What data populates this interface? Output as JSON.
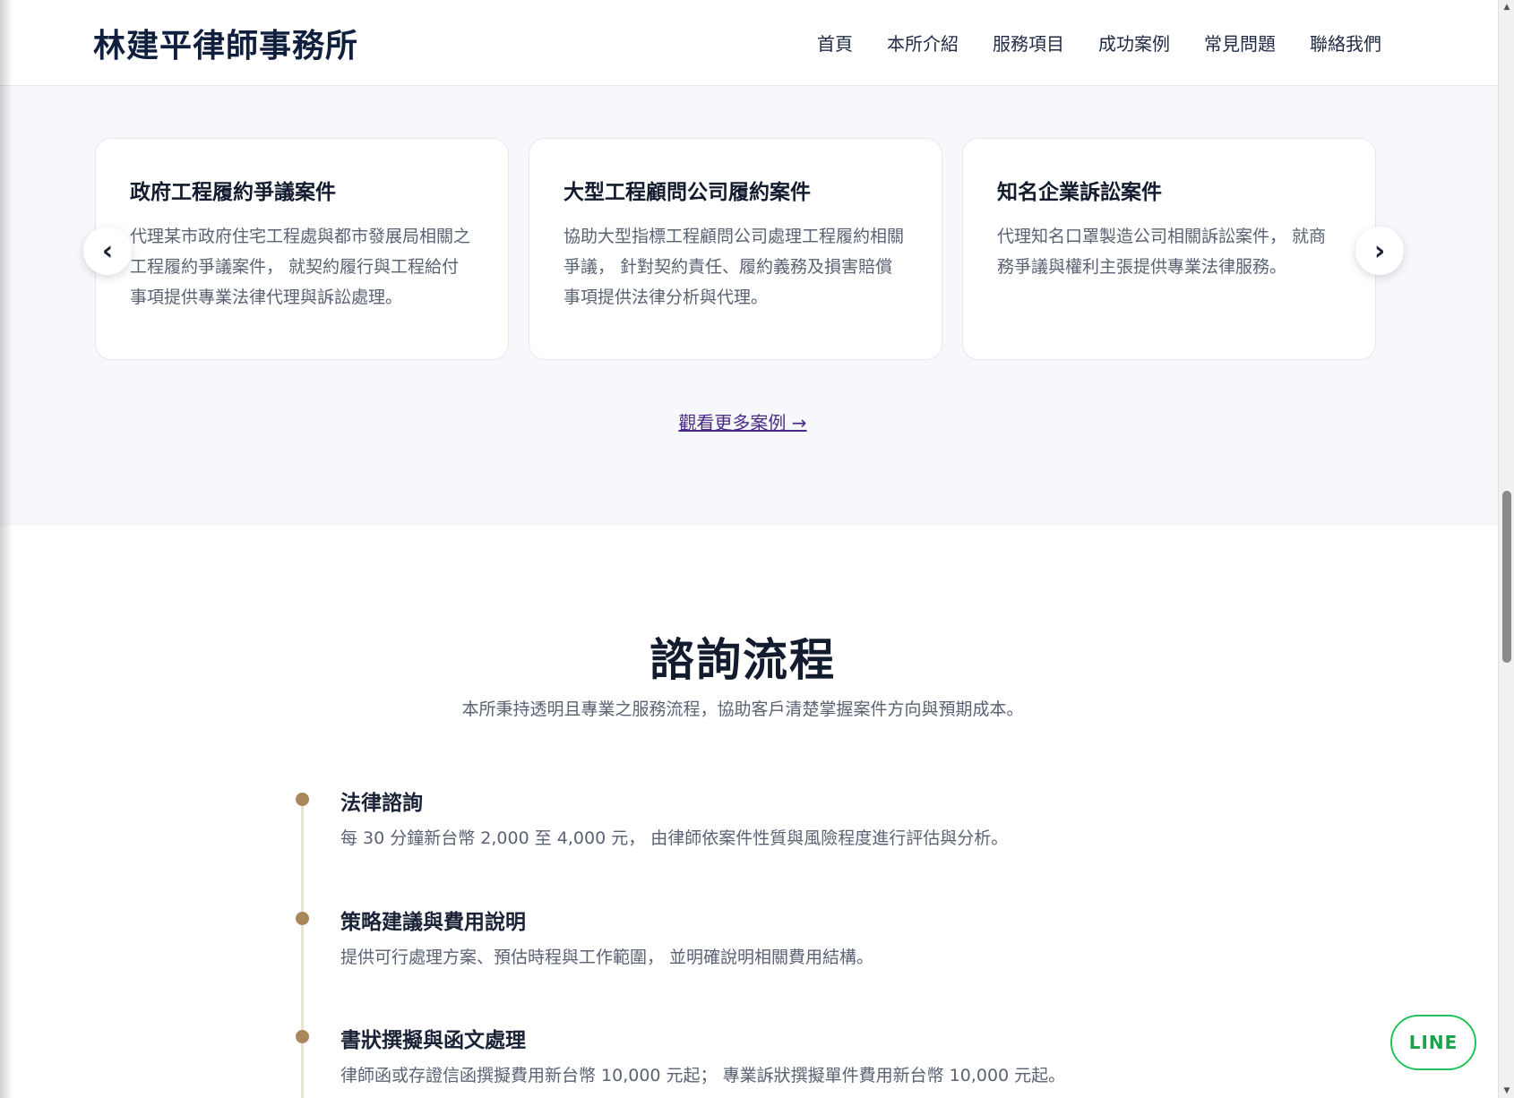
{
  "header": {
    "brand": "林建平律師事務所",
    "nav": [
      "首頁",
      "本所介紹",
      "服務項目",
      "成功案例",
      "常見問題",
      "聯絡我們"
    ]
  },
  "cases": {
    "cards": [
      {
        "title": "政府工程履約爭議案件",
        "desc": "代理某市政府住宅工程處與都市發展局相關之工程履約爭議案件， 就契約履行與工程給付事項提供專業法律代理與訴訟處理。"
      },
      {
        "title": "大型工程顧問公司履約案件",
        "desc": "協助大型指標工程顧問公司處理工程履約相關爭議， 針對契約責任、履約義務及損害賠償事項提供法律分析與代理。"
      },
      {
        "title": "知名企業訴訟案件",
        "desc": "代理知名口罩製造公司相關訴訟案件， 就商務爭議與權利主張提供專業法律服務。"
      }
    ],
    "prev_label": "‹",
    "next_label": "›",
    "more_link": "觀看更多案例 →"
  },
  "process": {
    "title": "諮詢流程",
    "subtitle": "本所秉持透明且專業之服務流程，協助客戶清楚掌握案件方向與預期成本。",
    "steps": [
      {
        "title": "法律諮詢",
        "desc": "每 30 分鐘新台幣 2,000 至 4,000 元， 由律師依案件性質與風險程度進行評估與分析。"
      },
      {
        "title": "策略建議與費用說明",
        "desc": "提供可行處理方案、預估時程與工作範圍， 並明確說明相關費用結構。"
      },
      {
        "title": "書狀撰擬與函文處理",
        "desc": "律師函或存證信函撰擬費用新台幣 10,000 元起； 專業訴狀撰擬單件費用新台幣 10,000 元起。"
      }
    ]
  },
  "line_button": "LINE",
  "colors": {
    "brand": "#0f1f3d",
    "accent_gold": "#a9875a",
    "line_green": "#22c55e",
    "link_purple": "#4b2a87"
  }
}
